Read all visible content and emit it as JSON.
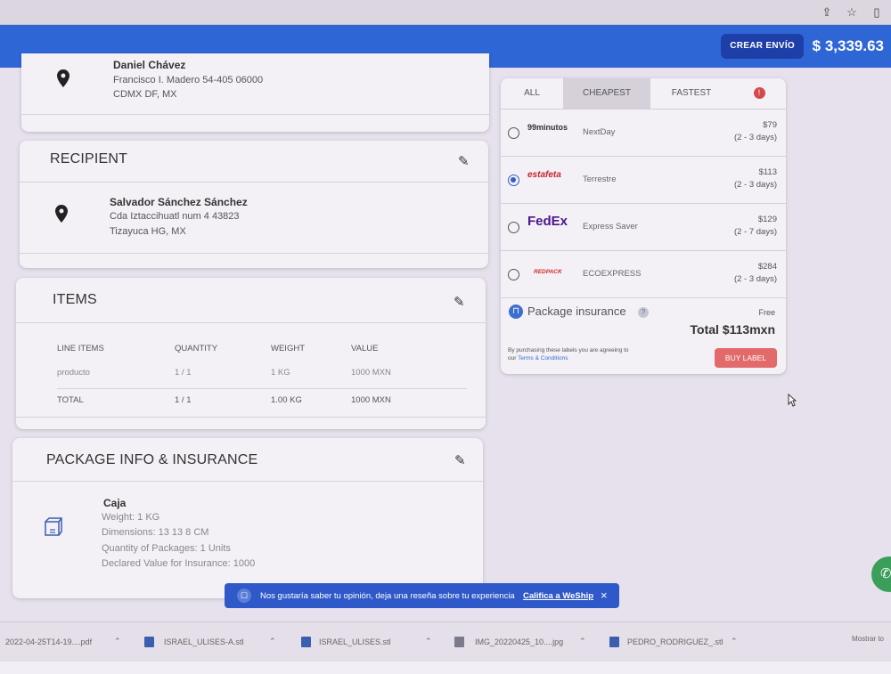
{
  "header": {
    "create_label": "CREAR ENVÍO",
    "balance": "$ 3,339.63",
    "brand_color": "#2f66d6"
  },
  "sender": {
    "name": "Daniel Chávez",
    "line1": "Francisco I. Madero 54-405 06000",
    "line2": "CDMX DF, MX"
  },
  "recipient": {
    "title": "RECIPIENT",
    "name": "Salvador Sánchez Sánchez",
    "line1": "Cda Iztaccihuatl num 4 43823",
    "line2": "Tizayuca HG, MX"
  },
  "items": {
    "title": "ITEMS",
    "columns": [
      "LINE ITEMS",
      "QUANTITY",
      "WEIGHT",
      "VALUE"
    ],
    "rows": [
      [
        "producto",
        "1 / 1",
        "1 KG",
        "1000 MXN"
      ]
    ],
    "total": [
      "TOTAL",
      "1 / 1",
      "1.00 KG",
      "1000 MXN"
    ]
  },
  "package": {
    "title": "PACKAGE INFO & INSURANCE",
    "type": "Caja",
    "weight": "Weight: 1 KG",
    "dimensions": "Dimensions: 13 13 8 CM",
    "quantity": "Quantity of Packages: 1 Units",
    "declared": "Declared Value for Insurance: 1000"
  },
  "rates": {
    "tabs": [
      "ALL",
      "CHEAPEST",
      "FASTEST"
    ],
    "active_tab": "CHEAPEST",
    "carriers": [
      {
        "logo": "99minutos",
        "service": "NextDay",
        "price": "$79",
        "days": "(2 - 3 days)",
        "selected": false
      },
      {
        "logo": "estafeta",
        "service": "Terrestre",
        "price": "$113",
        "days": "(2 - 3 days)",
        "selected": true
      },
      {
        "logo": "FedEx",
        "service": "Express Saver",
        "price": "$129",
        "days": "(2 - 7 days)",
        "selected": false
      },
      {
        "logo": "REDPACK",
        "service": "ECOEXPRESS",
        "price": "$284",
        "days": "(2 - 3 days)",
        "selected": false
      }
    ],
    "insurance_label": "Package insurance",
    "insurance_value": "Free",
    "total": "Total $113mxn",
    "terms_prefix": "By purchasing these labels you are agreeing to our",
    "terms_link": "Terms & Conditions",
    "buy_label": "BUY LABEL"
  },
  "toast": {
    "message": "Nos gustaría saber tu opinión, deja una reseña sobre tu experiencia",
    "link": "Califica a WeShip",
    "close": "×"
  },
  "downloads": {
    "files": [
      "2022-04-25T14-19....pdf",
      "ISRAEL_ULISES-A.stl",
      "ISRAEL_ULISES.stl",
      "IMG_20220425_10....jpg",
      "PEDRO_RODRIGUEZ_.stl"
    ],
    "show_all": "Mostrar to"
  }
}
